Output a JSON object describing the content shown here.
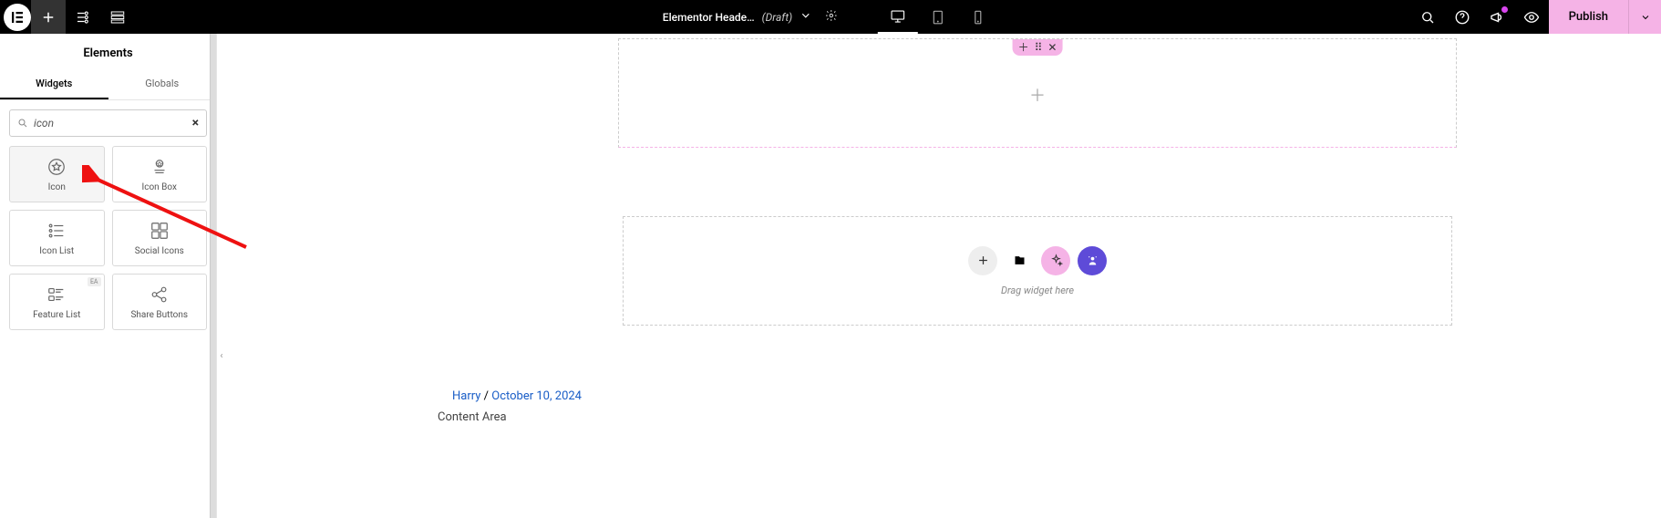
{
  "topbar": {
    "doc_title": "Elementor Heade…",
    "doc_status": "(Draft)",
    "publish_label": "Publish"
  },
  "sidebar": {
    "title": "Elements",
    "tabs": {
      "widgets": "Widgets",
      "globals": "Globals"
    },
    "search_value": "icon",
    "widgets": [
      {
        "label": "Icon"
      },
      {
        "label": "Icon Box"
      },
      {
        "label": "Icon List"
      },
      {
        "label": "Social Icons"
      },
      {
        "label": "Feature List",
        "badge": "EA"
      },
      {
        "label": "Share Buttons"
      }
    ]
  },
  "canvas": {
    "drop_hint": "Drag widget here",
    "meta_author": "Harry",
    "meta_sep": " / ",
    "meta_date": "October 10, 2024",
    "content_area": "Content Area"
  }
}
